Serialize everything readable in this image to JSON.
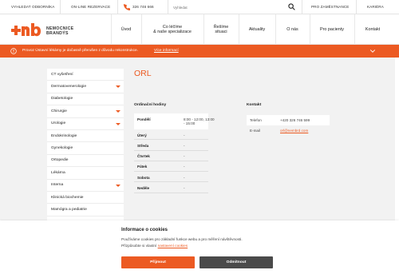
{
  "topbar": {
    "find_doctor": "VYHLEDAT ODBORNÍKA",
    "online_booking": "ON-LINE REZERVACE",
    "phone": "326 746 666",
    "search_placeholder": "Vyhledat",
    "for_employees": "PRO ZAMĚSTNANCE",
    "career": "KARIÉRA"
  },
  "brand": {
    "line1": "NEMOCNICE",
    "line2": "BRANDÝS",
    "accent_color": "#ec5a22"
  },
  "nav": {
    "items": [
      {
        "line1": "Úvod",
        "line2": ""
      },
      {
        "line1": "Co léčíme",
        "line2": "& naše specializace"
      },
      {
        "line1": "Řešíme",
        "line2": "situaci"
      },
      {
        "line1": "Aktuality",
        "line2": ""
      },
      {
        "line1": "O nás",
        "line2": ""
      },
      {
        "line1": "Pro pacienty",
        "line2": ""
      },
      {
        "line1": "Kontakt",
        "line2": ""
      }
    ]
  },
  "alert": {
    "text": "Provoz Ústavní lékárny je dočasně přerušen z důvodu rekonstrukce.",
    "link": "Více informací",
    "icon": "info-icon",
    "color": "#ec5a22"
  },
  "sidebar": {
    "items": [
      {
        "label": "CT vyšetření",
        "has_submenu": false
      },
      {
        "label": "Dermatovenerologie",
        "has_submenu": true
      },
      {
        "label": "Diabetologie",
        "has_submenu": false
      },
      {
        "label": "Chirurgie",
        "has_submenu": true
      },
      {
        "label": "Urologie",
        "has_submenu": true
      },
      {
        "label": "Endokrinologie",
        "has_submenu": false
      },
      {
        "label": "Gynekologie",
        "has_submenu": false
      },
      {
        "label": "Ortopedie",
        "has_submenu": false
      },
      {
        "label": "Lékárna",
        "has_submenu": false
      },
      {
        "label": "Interna",
        "has_submenu": true
      },
      {
        "label": "Klinická biochemie",
        "has_submenu": false
      },
      {
        "label": "Mamógra a pediatrie",
        "has_submenu": false
      }
    ]
  },
  "page": {
    "title": "ORL",
    "hours_label": "Ordinační hodiny",
    "contact_label": "Kontakt"
  },
  "hours": [
    {
      "day": "Pondělí",
      "value_line1": "8:00 - 12:00, 13:00",
      "value_line2": "- 15:00"
    },
    {
      "day": "Úterý",
      "value_line1": "-",
      "value_line2": ""
    },
    {
      "day": "Středa",
      "value_line1": "-",
      "value_line2": ""
    },
    {
      "day": "Čtvrtek",
      "value_line1": "-",
      "value_line2": ""
    },
    {
      "day": "Pátek",
      "value_line1": "-",
      "value_line2": ""
    },
    {
      "day": "Sobota",
      "value_line1": "-",
      "value_line2": ""
    },
    {
      "day": "Neděle",
      "value_line1": "-",
      "value_line2": ""
    }
  ],
  "contact": {
    "phone_label": "Telefon",
    "phone_value": "+420 326 746 599",
    "email_label": "E-mail",
    "email_value": "orl@nembrd.com"
  },
  "cookies": {
    "title": "Informace o cookies",
    "text1": "Používáme cookies pro základní funkce webu a pro měření návštěvnosti.",
    "text2_prefix": "Přizpůsobte si vlastní ",
    "text2_link": "nastavení cookies",
    "accept": "Přijmout",
    "refuse": "Odmítnout"
  }
}
